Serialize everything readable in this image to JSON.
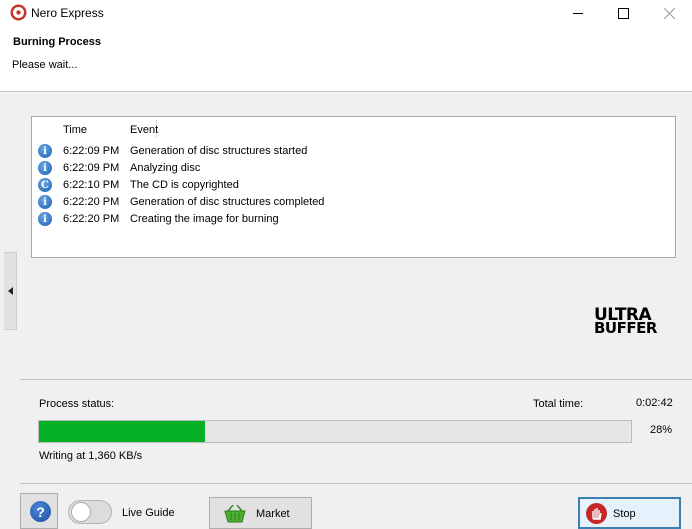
{
  "window": {
    "title": "Nero Express",
    "controls": [
      "minimize",
      "maximize",
      "close"
    ]
  },
  "header": {
    "title": "Burning Process",
    "subtitle": "Please wait..."
  },
  "log": {
    "columns": {
      "time": "Time",
      "event": "Event"
    },
    "rows": [
      {
        "icon": "info-icon",
        "time": "6:22:09 PM",
        "event": "Generation of disc structures started"
      },
      {
        "icon": "info-icon",
        "time": "6:22:09 PM",
        "event": "Analyzing disc"
      },
      {
        "icon": "copyright-icon",
        "time": "6:22:10 PM",
        "event": "The CD is copyrighted"
      },
      {
        "icon": "info-icon",
        "time": "6:22:20 PM",
        "event": "Generation of disc structures completed"
      },
      {
        "icon": "info-icon",
        "time": "6:22:20 PM",
        "event": "Creating the image for burning"
      }
    ]
  },
  "logo": {
    "top": "ULTRA",
    "bottom": "BUFFER"
  },
  "status": {
    "label": "Process status:",
    "total_time_label": "Total time:",
    "total_time": "0:02:42",
    "progress_percent": 28,
    "progress_text": "28%",
    "writing": "Writing at 1,360 KB/s",
    "progress_color": "#06b025"
  },
  "footer": {
    "help_symbol": "?",
    "live_guide": "Live Guide",
    "live_guide_on": false,
    "market": "Market",
    "stop": "Stop"
  }
}
